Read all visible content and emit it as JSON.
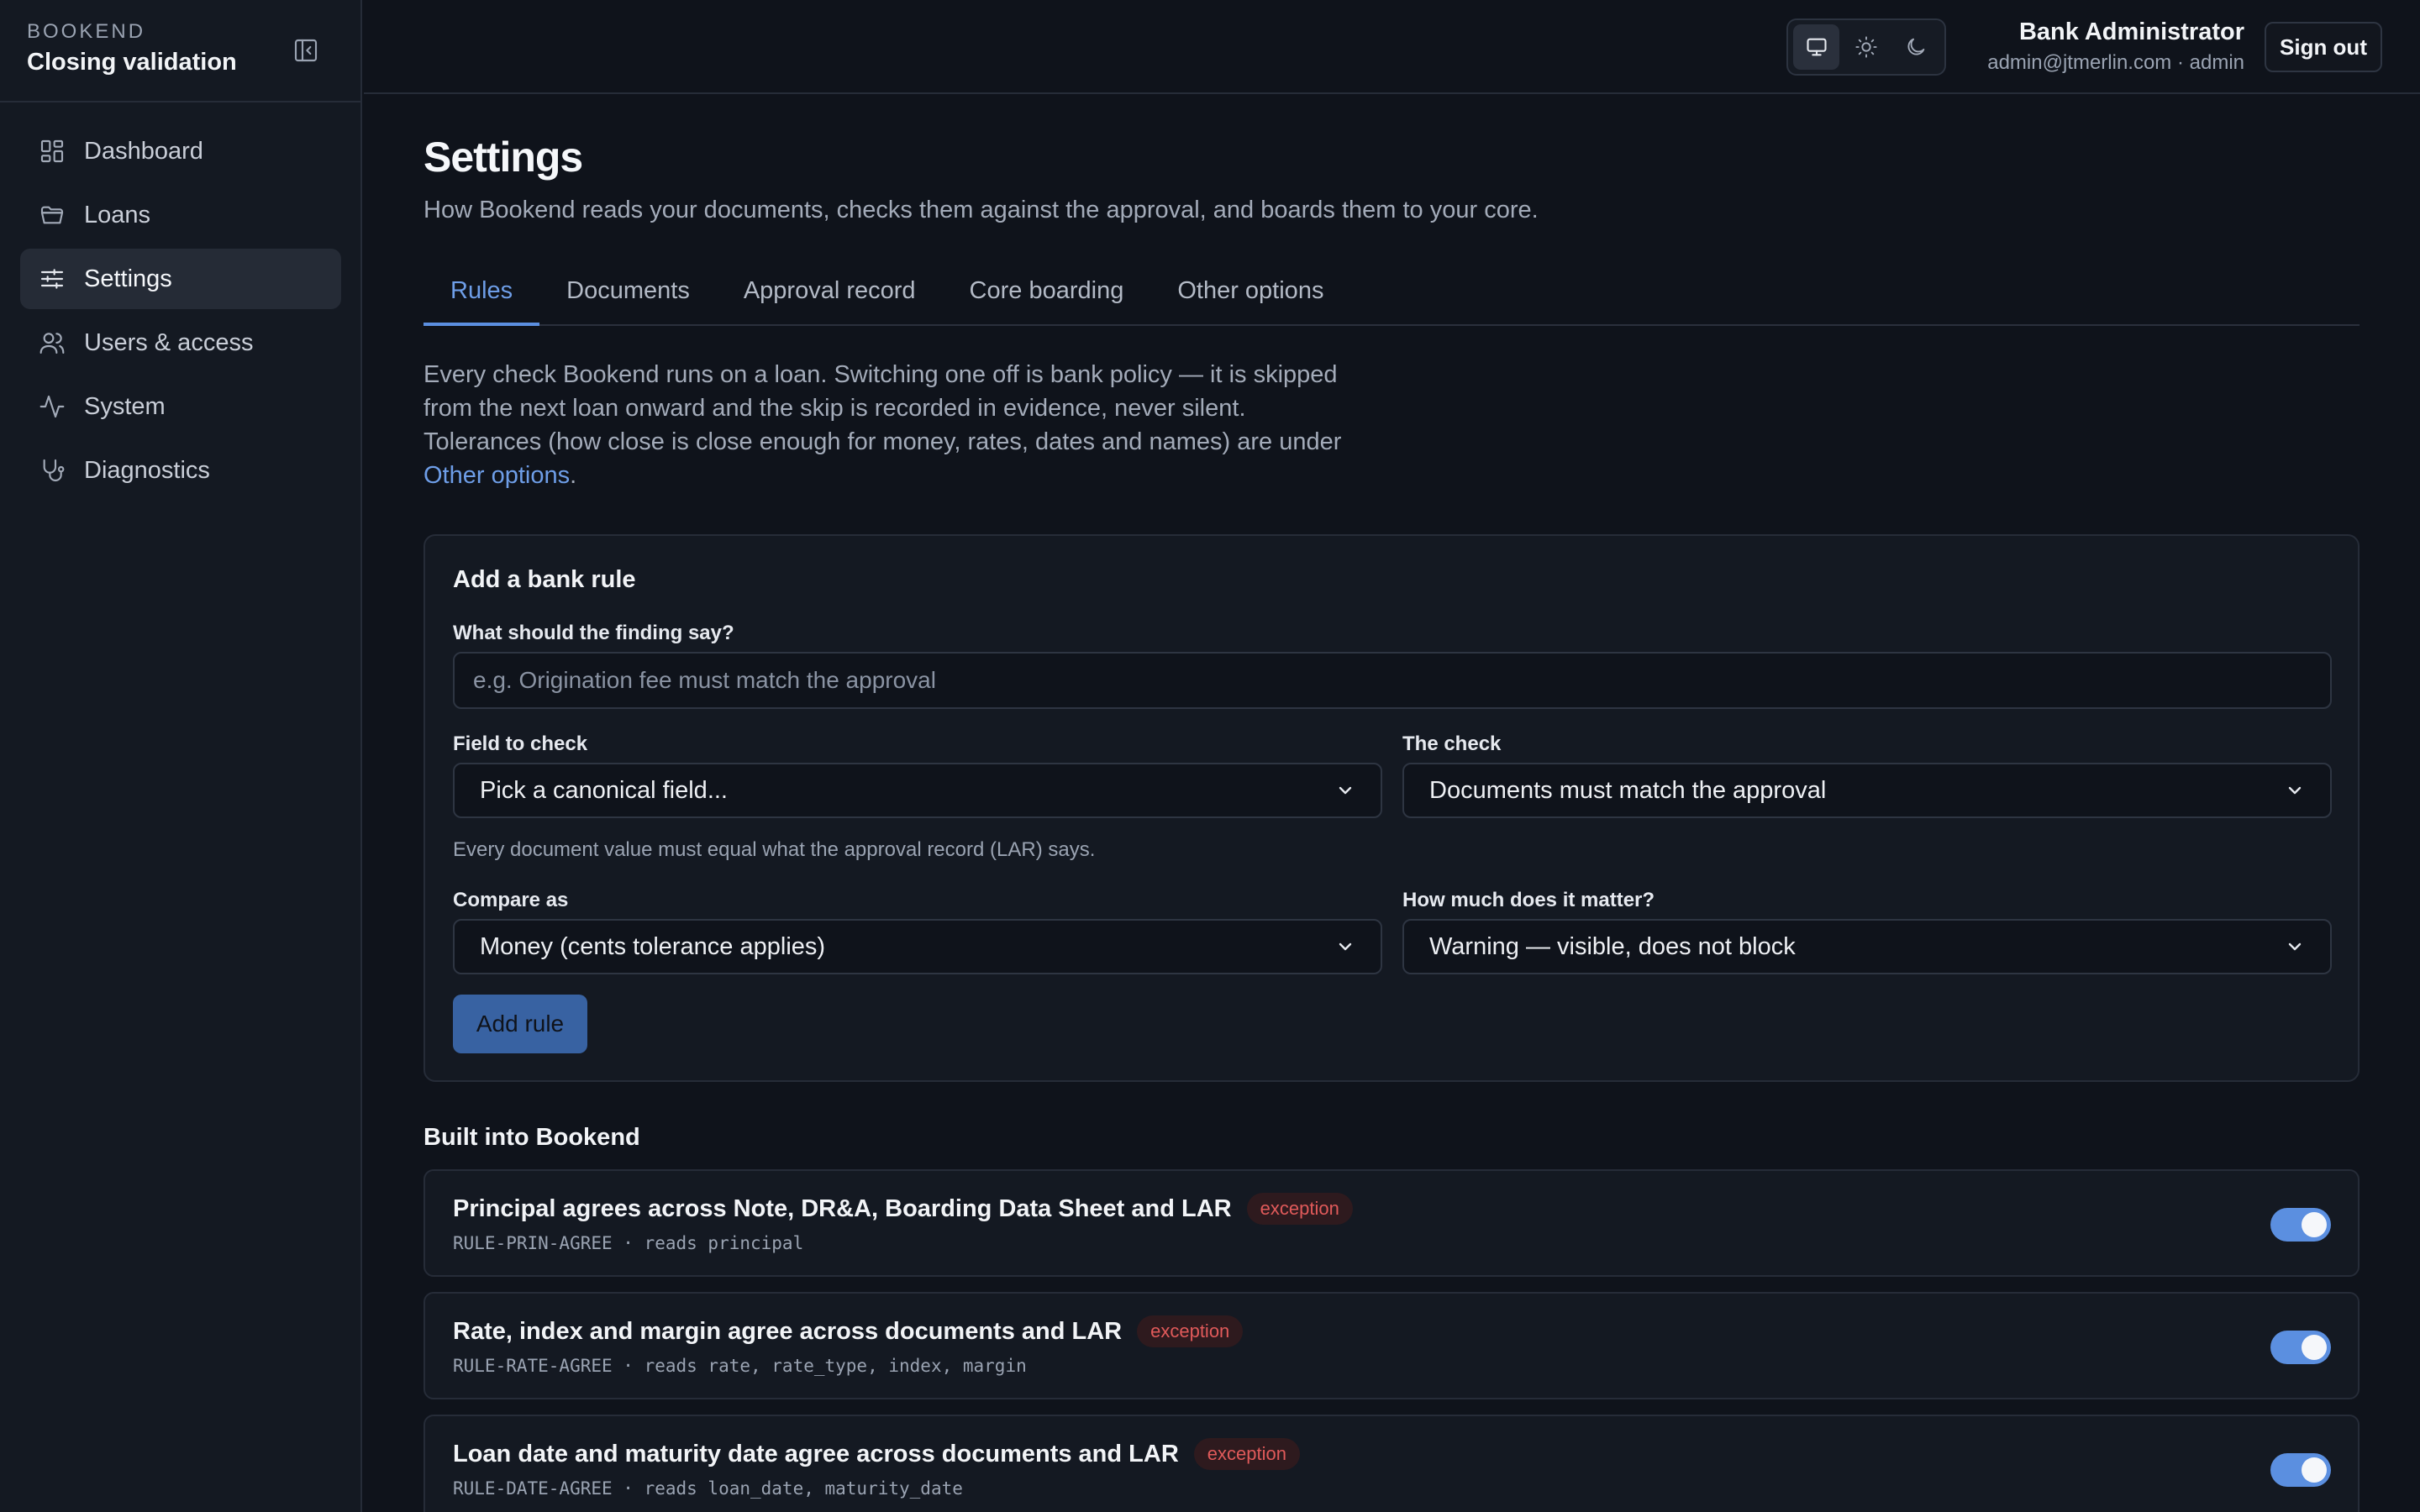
{
  "brand": {
    "small": "BOOKEND",
    "title": "Closing validation"
  },
  "sidebar": {
    "items": [
      {
        "label": "Dashboard",
        "icon": "dashboard-icon"
      },
      {
        "label": "Loans",
        "icon": "folder-icon"
      },
      {
        "label": "Settings",
        "icon": "sliders-icon",
        "active": true
      },
      {
        "label": "Users & access",
        "icon": "users-icon"
      },
      {
        "label": "System",
        "icon": "activity-icon"
      },
      {
        "label": "Diagnostics",
        "icon": "stethoscope-icon"
      }
    ]
  },
  "header": {
    "theme_options": [
      "monitor-icon",
      "sun-icon",
      "moon-icon"
    ],
    "theme_active": "monitor-icon",
    "user_name": "Bank Administrator",
    "user_email": "admin@jtmerlin.com · admin",
    "sign_out": "Sign out"
  },
  "page": {
    "title": "Settings",
    "subtitle": "How Bookend reads your documents, checks them against the approval, and boards them to your core.",
    "tabs": [
      {
        "label": "Rules",
        "active": true
      },
      {
        "label": "Documents"
      },
      {
        "label": "Approval record"
      },
      {
        "label": "Core boarding"
      },
      {
        "label": "Other options"
      }
    ],
    "intro_lines": [
      "Every check Bookend runs on a loan. Switching one off is bank policy — it is skipped",
      "from the next loan onward and the skip is recorded in evidence, never silent.",
      "Tolerances (how close is close enough for money, rates, dates and names) are under"
    ],
    "intro_link": "Other options",
    "intro_end": "."
  },
  "form": {
    "title": "Add a bank rule",
    "finding_label": "What should the finding say?",
    "finding_placeholder": "e.g. Origination fee must match the approval",
    "field_label": "Field to check",
    "field_value": "Pick a canonical field...",
    "check_label": "The check",
    "check_value": "Documents must match the approval",
    "check_hint": "Every document value must equal what the approval record (LAR) says.",
    "compare_label": "Compare as",
    "compare_value": "Money (cents tolerance applies)",
    "severity_label": "How much does it matter?",
    "severity_value": "Warning — visible, does not block",
    "add_button": "Add rule"
  },
  "builtin": {
    "title": "Built into Bookend",
    "rules": [
      {
        "name": "Principal agrees across Note, DR&A, Boarding Data Sheet and LAR",
        "badge": "exception",
        "meta": "RULE-PRIN-AGREE · reads principal",
        "enabled": true
      },
      {
        "name": "Rate, index and margin agree across documents and LAR",
        "badge": "exception",
        "meta": "RULE-RATE-AGREE · reads rate, rate_type, index, margin",
        "enabled": true
      },
      {
        "name": "Loan date and maturity date agree across documents and LAR",
        "badge": "exception",
        "meta": "RULE-DATE-AGREE · reads loan_date, maturity_date",
        "enabled": true
      }
    ]
  },
  "colors": {
    "accent": "#5b8fe0",
    "badge_red": "#e05a5a",
    "background": "#0f131b",
    "sidebar": "#141922"
  }
}
